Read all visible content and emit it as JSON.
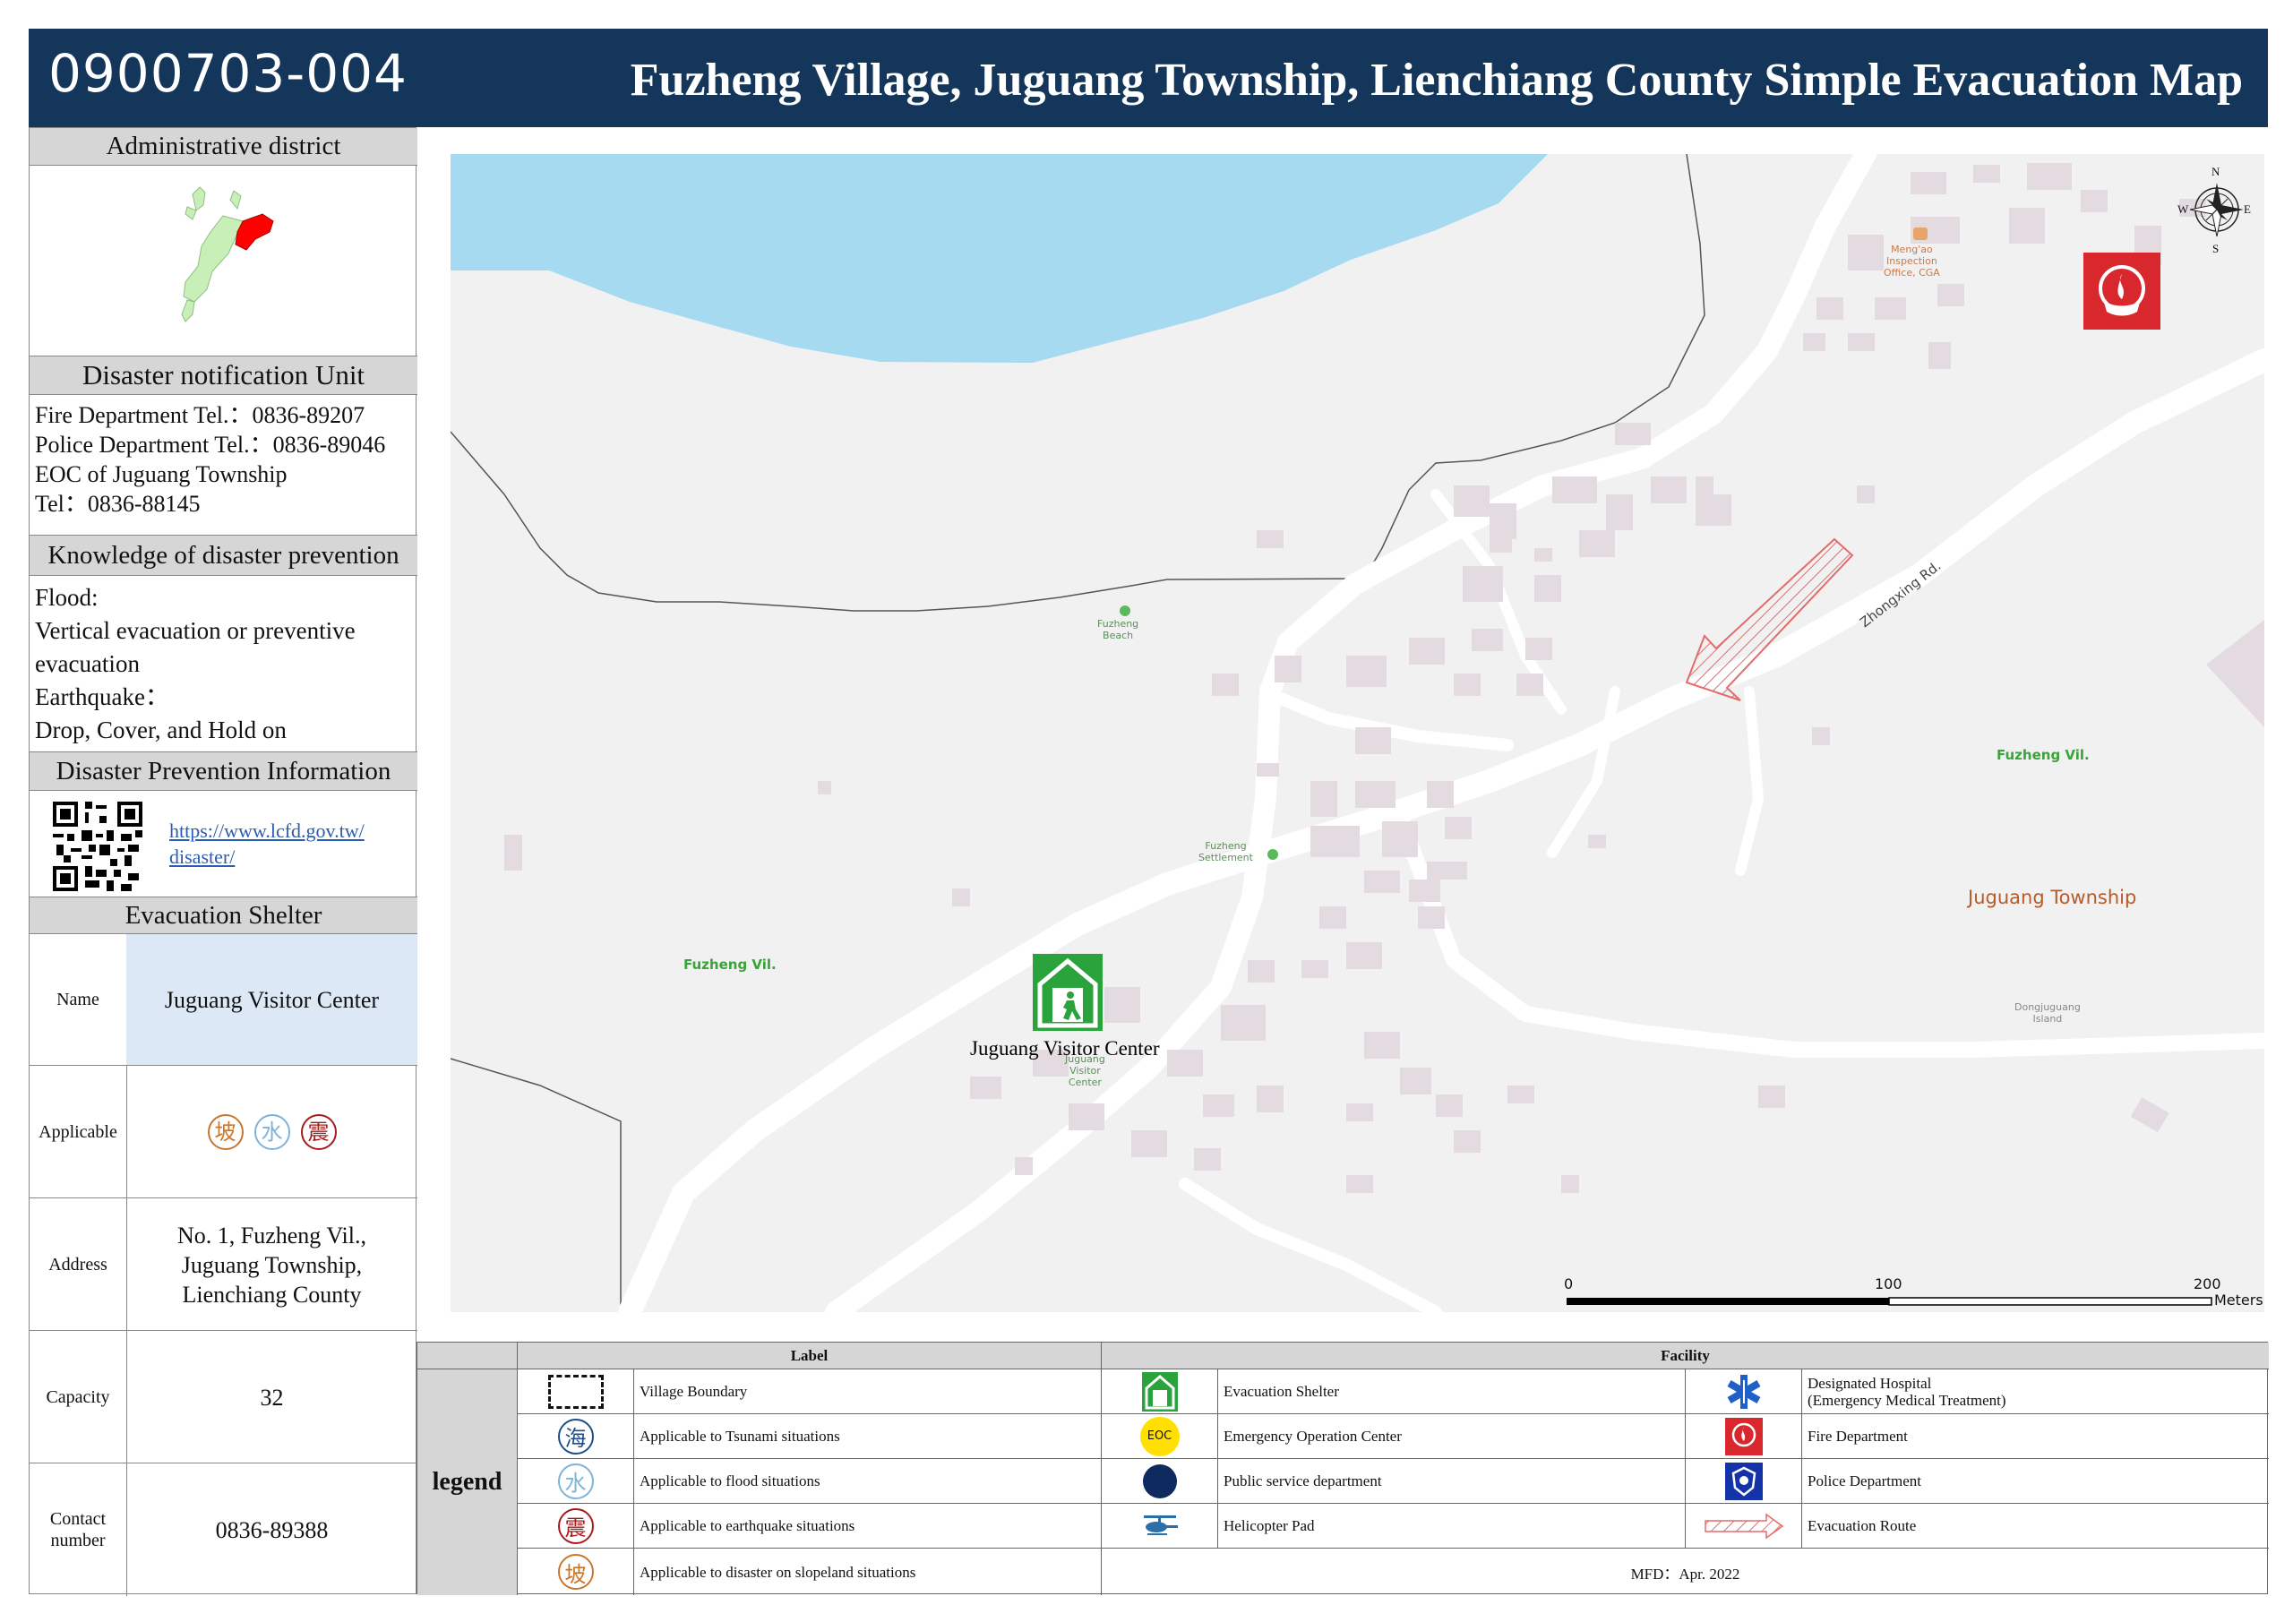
{
  "header": {
    "map_id": "0900703-004",
    "title": "Fuzheng Village, Juguang Township, Lienchiang County Simple Evacuation Map"
  },
  "colors": {
    "header_bg": "#14365a",
    "sea": "#a6daf0",
    "land": "#f2f1f1",
    "building": "#e4dbe1",
    "evac_route": "#e36b6b",
    "district_highlight": "#ff0000",
    "district_land": "#c8efb8",
    "label_green": "#3aa33a",
    "label_township": "#b55a2a"
  },
  "left_panel": {
    "admin_title": "Administrative district",
    "notify_title": "Disaster notification Unit",
    "notify_lines": [
      "Fire Department Tel.：0836-89207",
      "Police Department Tel.：0836-89046",
      "EOC of Juguang Township",
      "Tel：0836-88145"
    ],
    "knowledge_title": "Knowledge of disaster prevention",
    "knowledge_lines": [
      "Flood:",
      "Vertical evacuation or preventive",
      "evacuation",
      "Earthquake：",
      "Drop, Cover, and Hold on"
    ],
    "info_title": "Disaster Prevention Information",
    "info_link_1": "https://www.lcfd.gov.tw/",
    "info_link_2": "disaster/",
    "shelter_title": "Evacuation Shelter",
    "shelter": {
      "name_label": "Name",
      "name_value": "Juguang Visitor Center",
      "applicable_label": "Applicable",
      "applicable_icons": [
        "坡",
        "水",
        "震"
      ],
      "address_label": "Address",
      "address_lines": [
        "No. 1, Fuzheng Vil.,",
        "Juguang Township,",
        "Lienchiang County"
      ],
      "capacity_label": "Capacity",
      "capacity_value": "32",
      "contact_label_1": "Contact",
      "contact_label_2": "number",
      "contact_value": "0836-89388"
    }
  },
  "map": {
    "labels": {
      "mengao_1": "Meng'ao",
      "mengao_2": "Inspection",
      "mengao_3": "Office, CGA",
      "beach_1": "Fuzheng",
      "beach_2": "Beach",
      "settlement_1": "Fuzheng",
      "settlement_2": "Settlement",
      "village_east": "Fuzheng Vil.",
      "village_west": "Fuzheng Vil.",
      "township": "Juguang Township",
      "island_1": "Dongjuguang",
      "island_2": "Island",
      "road": "Zhongxing Rd.",
      "visitor_1": "Juguang",
      "visitor_2": "Visitor",
      "visitor_3": "Center",
      "shelter_label": "Juguang Visitor Center"
    },
    "compass": {
      "n": "N",
      "s": "S",
      "e": "E",
      "w": "W"
    },
    "scale": {
      "t0": "0",
      "t1": "100",
      "t2": "200",
      "unit": "Meters"
    }
  },
  "legend": {
    "title": "legend",
    "label_header": "Label",
    "facility_header": "Facility",
    "labels": [
      {
        "icon": "village-boundary-icon",
        "text": "Village Boundary"
      },
      {
        "icon": "海",
        "text": "Applicable to Tsunami  situations"
      },
      {
        "icon": "水",
        "text": "Applicable to flood situations"
      },
      {
        "icon": "震",
        "text": "Applicable to earthquake situations"
      },
      {
        "icon": "坡",
        "text": "Applicable to disaster on slopeland situations"
      }
    ],
    "facilities_a": [
      {
        "icon": "evacuation-shelter-icon",
        "text": "Evacuation Shelter"
      },
      {
        "icon": "EOC",
        "text": "Emergency Operation Center"
      },
      {
        "icon": "public-service-icon",
        "text": "Public service department"
      },
      {
        "icon": "helicopter-icon",
        "text": "Helicopter Pad"
      }
    ],
    "facilities_b": [
      {
        "icon": "hospital-icon",
        "text_1": "Designated  Hospital",
        "text_2": "(Emergency Medical Treatment)"
      },
      {
        "icon": "fire-department-icon",
        "text_1": "Fire Department",
        "text_2": ""
      },
      {
        "icon": "police-department-icon",
        "text_1": "Police Department",
        "text_2": ""
      },
      {
        "icon": "evacuation-route-icon",
        "text_1": "Evacuation Route",
        "text_2": ""
      }
    ],
    "footer": "MFD：Apr. 2022"
  }
}
